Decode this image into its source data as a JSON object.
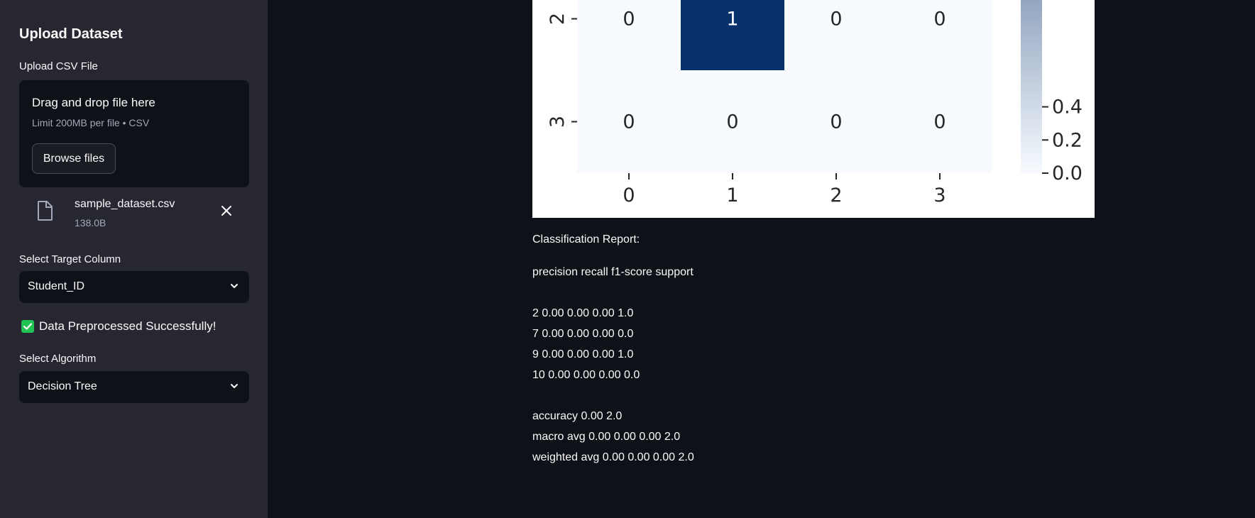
{
  "sidebar": {
    "title": "Upload Dataset",
    "upload_label": "Upload CSV File",
    "dropzone": {
      "title": "Drag and drop file here",
      "limit": "Limit 200MB per file • CSV",
      "browse_label": "Browse files"
    },
    "file": {
      "name": "sample_dataset.csv",
      "size": "138.0B",
      "icon": "file-icon"
    },
    "target": {
      "label": "Select Target Column",
      "value": "Student_ID"
    },
    "success_text": "Data Preprocessed Successfully!",
    "algorithm": {
      "label": "Select Algorithm",
      "value": "Decision Tree"
    }
  },
  "chart_data": {
    "type": "heatmap",
    "colormap": "Blues",
    "x_tick_labels": [
      "0",
      "1",
      "2",
      "3"
    ],
    "y_tick_labels_visible": [
      "2",
      "3"
    ],
    "rows_visible": [
      {
        "row": "2",
        "values": [
          0,
          1,
          0,
          0
        ]
      },
      {
        "row": "3",
        "values": [
          0,
          0,
          0,
          0
        ]
      }
    ],
    "colorbar": {
      "ticks": [
        "0.0",
        "0.2",
        "0.4"
      ],
      "range": [
        0,
        1
      ]
    }
  },
  "report": {
    "title": "Classification Report:",
    "header": "precision recall f1-score support",
    "class_lines": [
      "2 0.00 0.00 0.00 1.0",
      "7 0.00 0.00 0.00 0.0",
      "9 0.00 0.00 0.00 1.0",
      "10 0.00 0.00 0.00 0.0"
    ],
    "summary_lines": [
      "accuracy 0.00 2.0",
      "macro avg 0.00 0.00 0.00 2.0",
      "weighted avg 0.00 0.00 0.00 2.0"
    ]
  },
  "colors": {
    "sidebar_bg": "#262730",
    "main_bg": "#0e1117",
    "heat_high": "#08306b",
    "heat_low": "#f7fbff",
    "success_green": "#21c354"
  }
}
